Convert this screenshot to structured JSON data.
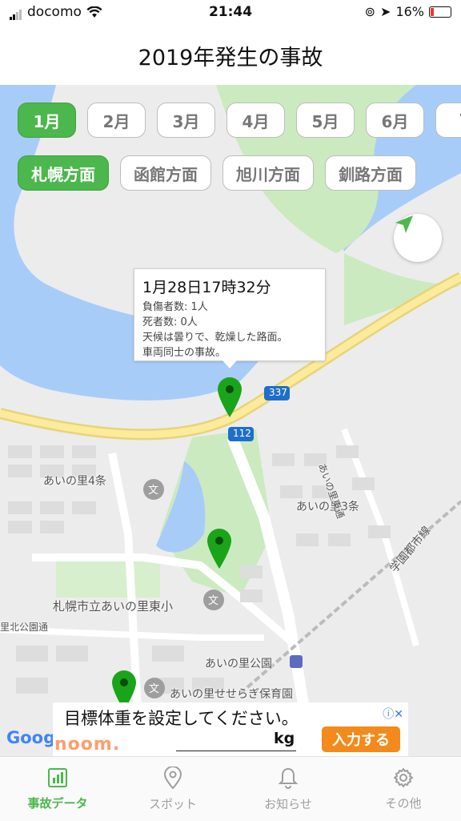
{
  "status": {
    "carrier": "docomo",
    "time": "21:44",
    "battery": "16%"
  },
  "header": {
    "title": "2019年発生の事故"
  },
  "months": [
    "1月",
    "2月",
    "3月",
    "4月",
    "5月",
    "6月",
    "7"
  ],
  "active_month": "1月",
  "regions": [
    "札幌方面",
    "函館方面",
    "旭川方面",
    "釧路方面"
  ],
  "active_region": "札幌方面",
  "callout": {
    "title": "1月28日17時32分",
    "injured": "負傷者数: 1人",
    "deaths": "死者数: 0人",
    "weather": "天候は曇りで、乾燥した路面。",
    "type": "車両同士の事故。"
  },
  "map_labels": {
    "area4": "あいの里4条",
    "area3": "あいの里3条",
    "school": "札幌市立あいの里東小",
    "park": "あいの里公園",
    "nursery": "あいの里せせらぎ保育園",
    "road_east": "あいの里東通",
    "rail": "学園都市線",
    "north_park": "里北公園通",
    "route337": "337",
    "route112": "112"
  },
  "ad": {
    "text": "目標体重を設定してください。",
    "brand": "noom.",
    "unit": "kg",
    "cta": "入力する"
  },
  "google": "Goog",
  "tabs": [
    {
      "label": "事故データ",
      "icon": "chart-icon"
    },
    {
      "label": "スポット",
      "icon": "location-pin-icon"
    },
    {
      "label": "お知らせ",
      "icon": "bell-icon"
    },
    {
      "label": "その他",
      "icon": "gear-icon"
    }
  ],
  "colors": {
    "accent": "#4cb74c",
    "pin": "#1aa41a",
    "water": "#a8ccf8",
    "park": "#cbeac0"
  }
}
